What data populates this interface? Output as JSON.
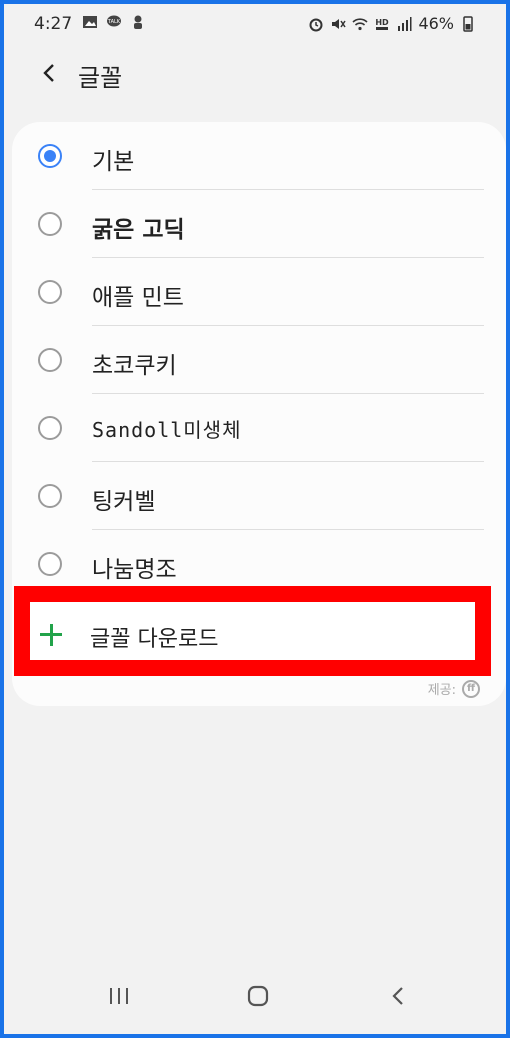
{
  "status_bar": {
    "time": "4:27",
    "left_icons": [
      "gallery-icon",
      "kakaotalk-icon",
      "notification-icon"
    ],
    "right_icons": [
      "alarm-icon",
      "mute-icon",
      "wifi-icon",
      "hd-voice-icon",
      "signal-icon"
    ],
    "battery": "46%"
  },
  "header": {
    "title": "글꼴",
    "back_icon": "chevron-left-icon"
  },
  "fonts": [
    {
      "label": "기본",
      "selected": true
    },
    {
      "label": "굵은 고딕",
      "selected": false
    },
    {
      "label": "애플 민트",
      "selected": false
    },
    {
      "label": "초코쿠키",
      "selected": false
    },
    {
      "label": "Sandoll미생체",
      "selected": false
    },
    {
      "label": "팅커벨",
      "selected": false
    },
    {
      "label": "나눔명조",
      "selected": false
    }
  ],
  "download": {
    "label": "글꼴 다운로드",
    "icon": "plus-icon",
    "highlight_color": "#ff0000"
  },
  "provider": {
    "label": "제공:",
    "icon": "ff-icon"
  },
  "nav": {
    "recents": "recents-icon",
    "home": "home-icon",
    "back": "back-icon"
  },
  "colors": {
    "accent": "#3a82f7",
    "plus": "#22a34a",
    "frame": "#1a73e8"
  }
}
